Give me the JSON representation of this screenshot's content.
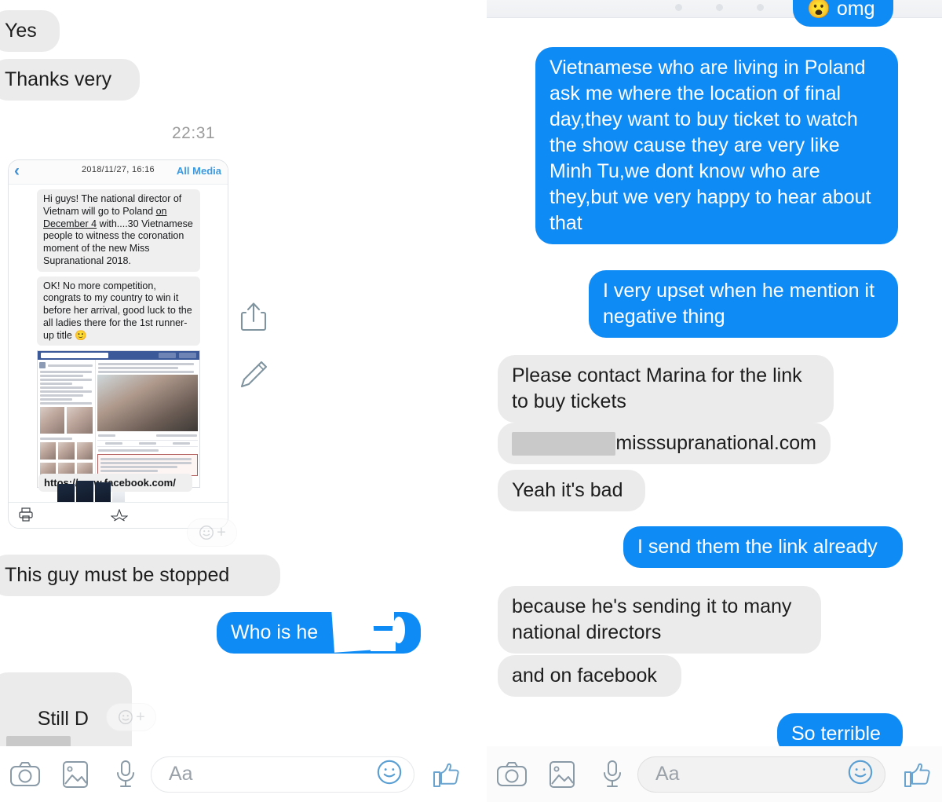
{
  "app": "Facebook Messenger conversation screenshots (two panels side by side)",
  "left_panel": {
    "timestamp": "22:31",
    "messages": [
      {
        "id": "yes",
        "side": "in",
        "text": "Yes"
      },
      {
        "id": "thanks-very",
        "side": "in",
        "text": "Thanks very"
      },
      {
        "id": "this-guy-must-be-stopped",
        "side": "in",
        "text": "This guy must be stopped"
      },
      {
        "id": "who-is-he",
        "side": "out",
        "text": "Who is he"
      },
      {
        "id": "still-d",
        "side": "in",
        "text": "Still D"
      }
    ],
    "attachment_screenshot": {
      "back_icon": "‹",
      "date": "2018/11/27, 16:16",
      "all_media_label": "All Media",
      "bubbles": [
        "Hi guys! The national director of Vietnam will go to Poland on December 4 with....30 Vietnamese people to witness the coronation moment of the new Miss Supranational 2018.",
        "OK! No more competition, congrats to my country to win it before her arrival, good luck to the all ladies there for the 1st runner-up title 🙂"
      ],
      "underlined_fragment": "on December 4",
      "link_text": "httos://www.facebook.com/"
    },
    "actions": {
      "share_label": "share-icon",
      "edit_label": "edit-icon",
      "reaction_label": "☺"
    },
    "composer": {
      "placeholder": "Aa",
      "camera_icon": "camera-icon",
      "gallery_icon": "gallery-icon",
      "mic_icon": "microphone-icon",
      "smiley_icon": "smiley-icon",
      "like_icon": "thumbs-up-icon"
    }
  },
  "right_panel": {
    "messages": [
      {
        "id": "omg",
        "side": "out",
        "text": "omg",
        "emoji": "😮",
        "clipped": true
      },
      {
        "id": "vietnamese-poland",
        "side": "out",
        "text": "Vietnamese who are living in Poland ask me where the location of final day,they want to buy ticket to watch the show cause they are very like Minh Tu,we dont know who are they,but we very happy to hear about that"
      },
      {
        "id": "very-upset",
        "side": "out",
        "text": "I very upset when he mention it negative thing"
      },
      {
        "id": "contact-marina",
        "side": "in",
        "text": "Please contact Marina for the link to buy tickets"
      },
      {
        "id": "link",
        "side": "in",
        "text": "misssupranational.com",
        "redacted_prefix": true
      },
      {
        "id": "yeah-its-bad",
        "side": "in",
        "text": "Yeah it's bad"
      },
      {
        "id": "sent-link",
        "side": "out",
        "text": "I send them the link already"
      },
      {
        "id": "many-directors",
        "side": "in",
        "text": "because he's sending it to many national directors"
      },
      {
        "id": "on-facebook",
        "side": "in",
        "text": "and on facebook"
      },
      {
        "id": "so-terrible",
        "side": "out",
        "text": "So terrible"
      }
    ],
    "actions": {
      "share_label": "share-icon"
    },
    "composer": {
      "placeholder": "Aa",
      "camera_icon": "camera-icon",
      "gallery_icon": "gallery-icon",
      "mic_icon": "microphone-icon",
      "smiley_icon": "smiley-icon",
      "like_icon": "thumbs-up-icon"
    }
  },
  "colors": {
    "outgoing_bubble": "#0f8bf5",
    "incoming_bubble": "#ebebeb",
    "text_dark": "#1d1d1d",
    "text_light": "#ffffff",
    "timestamp": "#9b9b9b",
    "icon": "#8a9aa6",
    "accent_link": "#3d9ae0",
    "redaction": "#c9c9c9"
  }
}
